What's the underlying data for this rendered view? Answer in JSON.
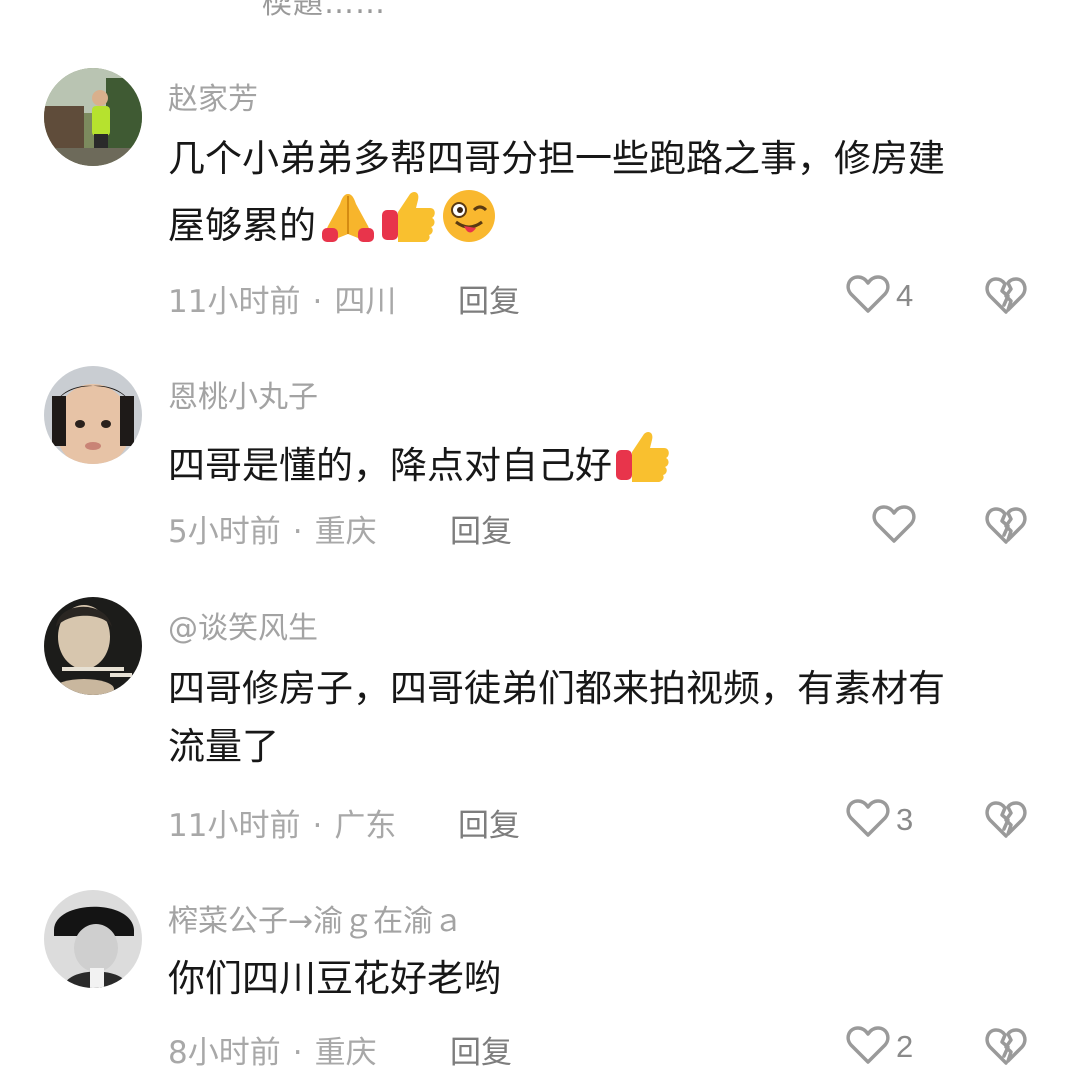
{
  "top_partial_text": "楔題……",
  "comments": [
    {
      "username": "赵家芳",
      "text_lines": [
        "几个小弟弟多帮四哥分担一些跑路之事，修房建",
        "屋够累的"
      ],
      "emojis": [
        "folded-hands",
        "thumbs-up",
        "winking-tongue-face"
      ],
      "time": "11小时前",
      "location": "四川",
      "reply_label": "回复",
      "likes": "4"
    },
    {
      "username": "恩桃小丸子",
      "text_lines": [
        "四哥是懂的，降点对自己好"
      ],
      "emojis": [
        "thumbs-up"
      ],
      "time": "5小时前",
      "location": "重庆",
      "reply_label": "回复",
      "likes": ""
    },
    {
      "username": "@谈笑风生",
      "text_lines": [
        "四哥修房子，四哥徒弟们都来拍视频，有素材有",
        "流量了"
      ],
      "emojis": [],
      "time": "11小时前",
      "location": "广东",
      "reply_label": "回复",
      "likes": "3"
    },
    {
      "username": "榨菜公子→渝ｇ在渝ａ",
      "text_lines": [
        "你们四川豆花好老哟"
      ],
      "emojis": [],
      "time": "8小时前",
      "location": "重庆",
      "reply_label": "回复",
      "likes": "2"
    }
  ],
  "separator": "·",
  "colors": {
    "username": "#a3a3a3",
    "meta": "#a8a8a8",
    "icon_stroke": "#9a9a9a"
  },
  "icons": {
    "like": "heart-outline-icon",
    "dislike": "broken-heart-icon"
  }
}
